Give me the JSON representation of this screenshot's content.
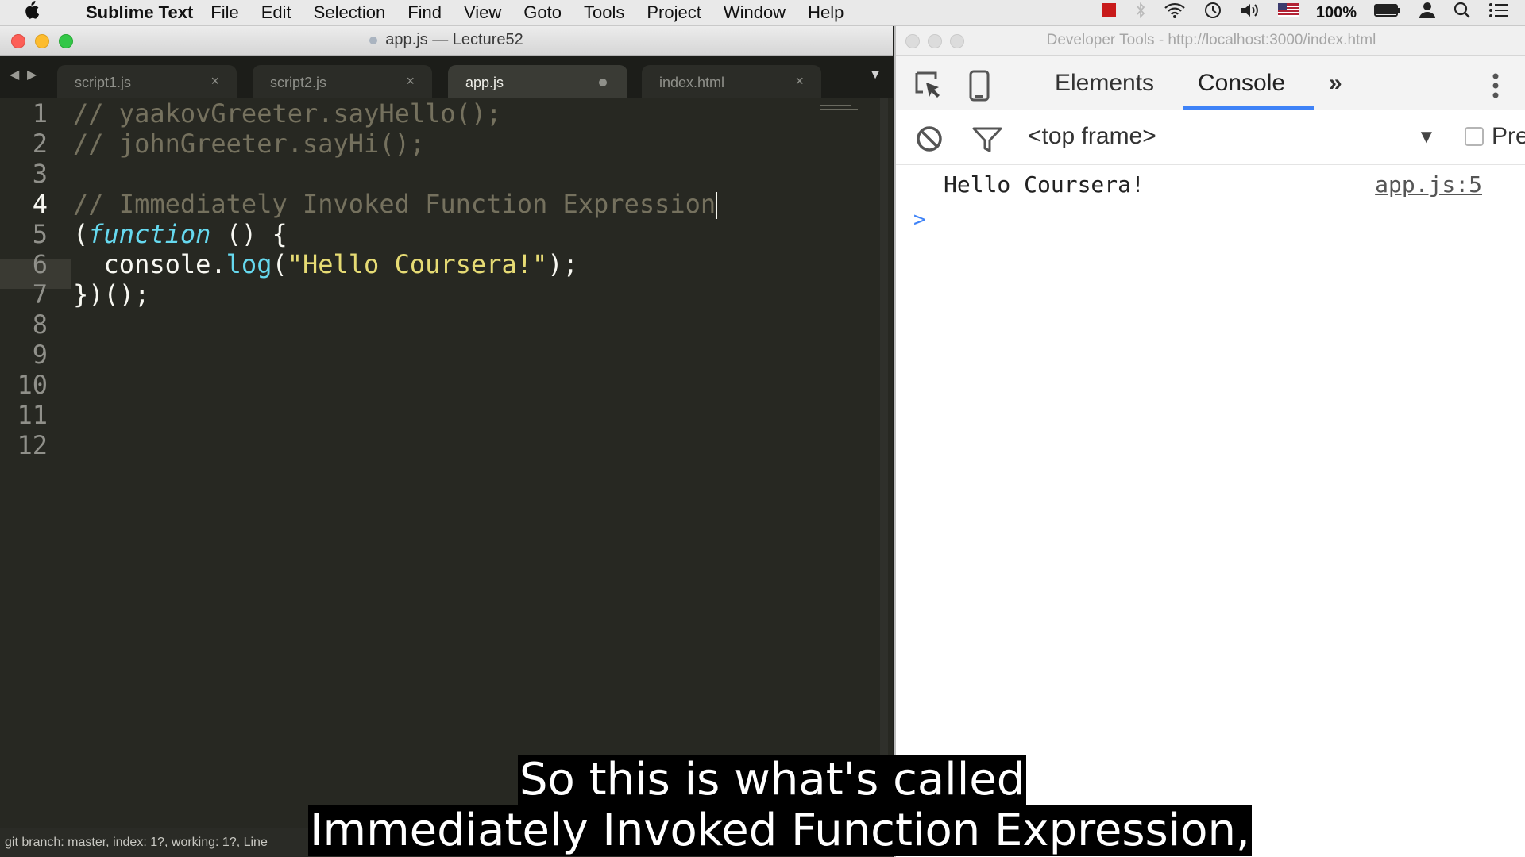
{
  "menubar": {
    "app_name": "Sublime Text",
    "items": [
      "File",
      "Edit",
      "Selection",
      "Find",
      "View",
      "Goto",
      "Tools",
      "Project",
      "Window",
      "Help"
    ],
    "battery": "100%"
  },
  "sublime": {
    "window_title": "app.js — Lecture52",
    "tabs": [
      {
        "label": "script1.js",
        "state": "close"
      },
      {
        "label": "script2.js",
        "state": "close"
      },
      {
        "label": "app.js",
        "state": "dirty"
      },
      {
        "label": "index.html",
        "state": "close"
      }
    ],
    "active_tab": 2,
    "line_numbers": [
      "1",
      "2",
      "3",
      "4",
      "5",
      "6",
      "7",
      "8",
      "9",
      "10",
      "11",
      "12"
    ],
    "current_line": 4,
    "code": {
      "line1": "// yaakovGreeter.sayHello();",
      "line2": "// johnGreeter.sayHi();",
      "line4": "// Immediately Invoked Function Expression",
      "line5_open": "(",
      "line5_kw": "function",
      "line5_rest": " () {",
      "line6_indent": "  console.",
      "line6_fn": "log",
      "line6_paren_open": "(",
      "line6_str": "\"Hello Coursera!\"",
      "line6_end": ");",
      "line7": "})();"
    },
    "status": "git branch: master, index: 1?, working: 1?, Line"
  },
  "devtools": {
    "window_title": "Developer Tools - http://localhost:3000/index.html",
    "tabs": [
      "Elements",
      "Console"
    ],
    "more_tabs": "»",
    "active_tab": "Console",
    "frame": "<top frame>",
    "preserve_label": "Pre",
    "console_messages": [
      {
        "text": "Hello Coursera!",
        "source": "app.js:5"
      }
    ],
    "prompt": ">"
  },
  "subtitles": {
    "line1": "So this is what's called",
    "line2": "Immediately Invoked Function Expression,"
  },
  "colors": {
    "editor_bg": "#272822",
    "comment": "#75715e",
    "keyword": "#66d9ef",
    "string": "#e6db74",
    "devtools_accent": "#3e82f7"
  }
}
